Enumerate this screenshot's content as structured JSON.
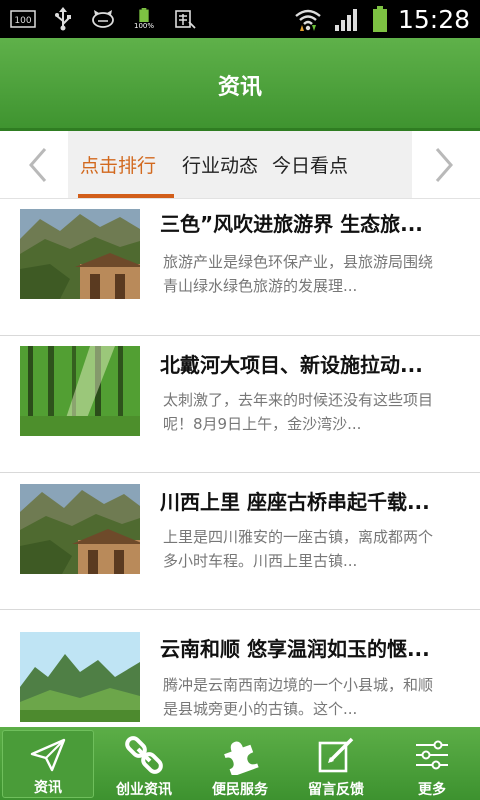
{
  "status_bar": {
    "left_icons": [
      "notification-100-icon",
      "usb-icon",
      "cat-icon",
      "battery-100-icon",
      "keyboard-icon"
    ],
    "battery_small_label": "100%",
    "notif_label": "100",
    "clock": "15:28"
  },
  "header": {
    "title": "资讯"
  },
  "tabs": [
    {
      "label": "点击排行",
      "active": true
    },
    {
      "label": "行业动态",
      "active": false
    },
    {
      "label": "今日看点",
      "active": false
    }
  ],
  "articles": [
    {
      "title": "三色”风吹进旅游界 生态旅...",
      "desc_line1": "旅游产业是绿色环保产业，县旅游局围绕",
      "desc_line2": "青山绿水绿色旅游的发展理..."
    },
    {
      "title": "北戴河大项目、新设施拉动...",
      "desc_line1": "太刺激了，去年来的时候还没有这些项目",
      "desc_line2": "呢！8月9日上午，金沙湾沙..."
    },
    {
      "title": "川西上里 座座古桥串起千载...",
      "desc_line1": "上里是四川雅安的一座古镇，离成都两个",
      "desc_line2": "多小时车程。川西上里古镇..."
    },
    {
      "title": "云南和顺 悠享温润如玉的惬...",
      "desc_line1": "腾冲是云南西南边境的一个小县城，和顺",
      "desc_line2": "是县城旁更小的古镇。这个..."
    }
  ],
  "bottom_nav": [
    {
      "label": "资讯",
      "icon": "paper-plane-icon",
      "active": true
    },
    {
      "label": "创业资讯",
      "icon": "chain-link-icon",
      "active": false
    },
    {
      "label": "便民服务",
      "icon": "puzzle-icon",
      "active": false
    },
    {
      "label": "留言反馈",
      "icon": "edit-note-icon",
      "active": false
    },
    {
      "label": "更多",
      "icon": "sliders-icon",
      "active": false
    }
  ],
  "colors": {
    "header_green": "#4fa43c",
    "active_tab_orange": "#d2691e",
    "nav_green": "#4a9c39"
  }
}
